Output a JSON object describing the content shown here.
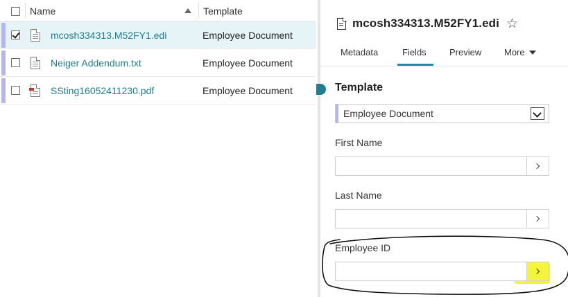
{
  "table": {
    "columns": {
      "name": "Name",
      "template": "Template"
    },
    "rows": [
      {
        "name": "mcosh334313.M52FY1.edi",
        "template": "Employee Document",
        "checked": true,
        "selected": true,
        "icon": "document-icon"
      },
      {
        "name": "Neiger Addendum.txt",
        "template": "Employee Document",
        "checked": false,
        "selected": false,
        "icon": "document-icon"
      },
      {
        "name": "SSting16052411230.pdf",
        "template": "Employee Document",
        "checked": false,
        "selected": false,
        "icon": "pdf-document-icon"
      }
    ]
  },
  "detail": {
    "title": "mcosh334313.M52FY1.edi",
    "tabs": {
      "metadata": "Metadata",
      "fields": "Fields",
      "preview": "Preview",
      "more": "More"
    },
    "active_tab": "Fields",
    "section_title": "Template",
    "template_select": "Employee Document",
    "fields": {
      "first_name": {
        "label": "First Name",
        "value": ""
      },
      "last_name": {
        "label": "Last Name",
        "value": ""
      },
      "employee_id": {
        "label": "Employee ID",
        "value": ""
      }
    }
  },
  "colors": {
    "link": "#1c7d8a",
    "accent": "#1e8aa0",
    "selection_bar": "#b8b5ec",
    "selected_row": "#e6f4f7",
    "highlight": "#f3f330"
  }
}
